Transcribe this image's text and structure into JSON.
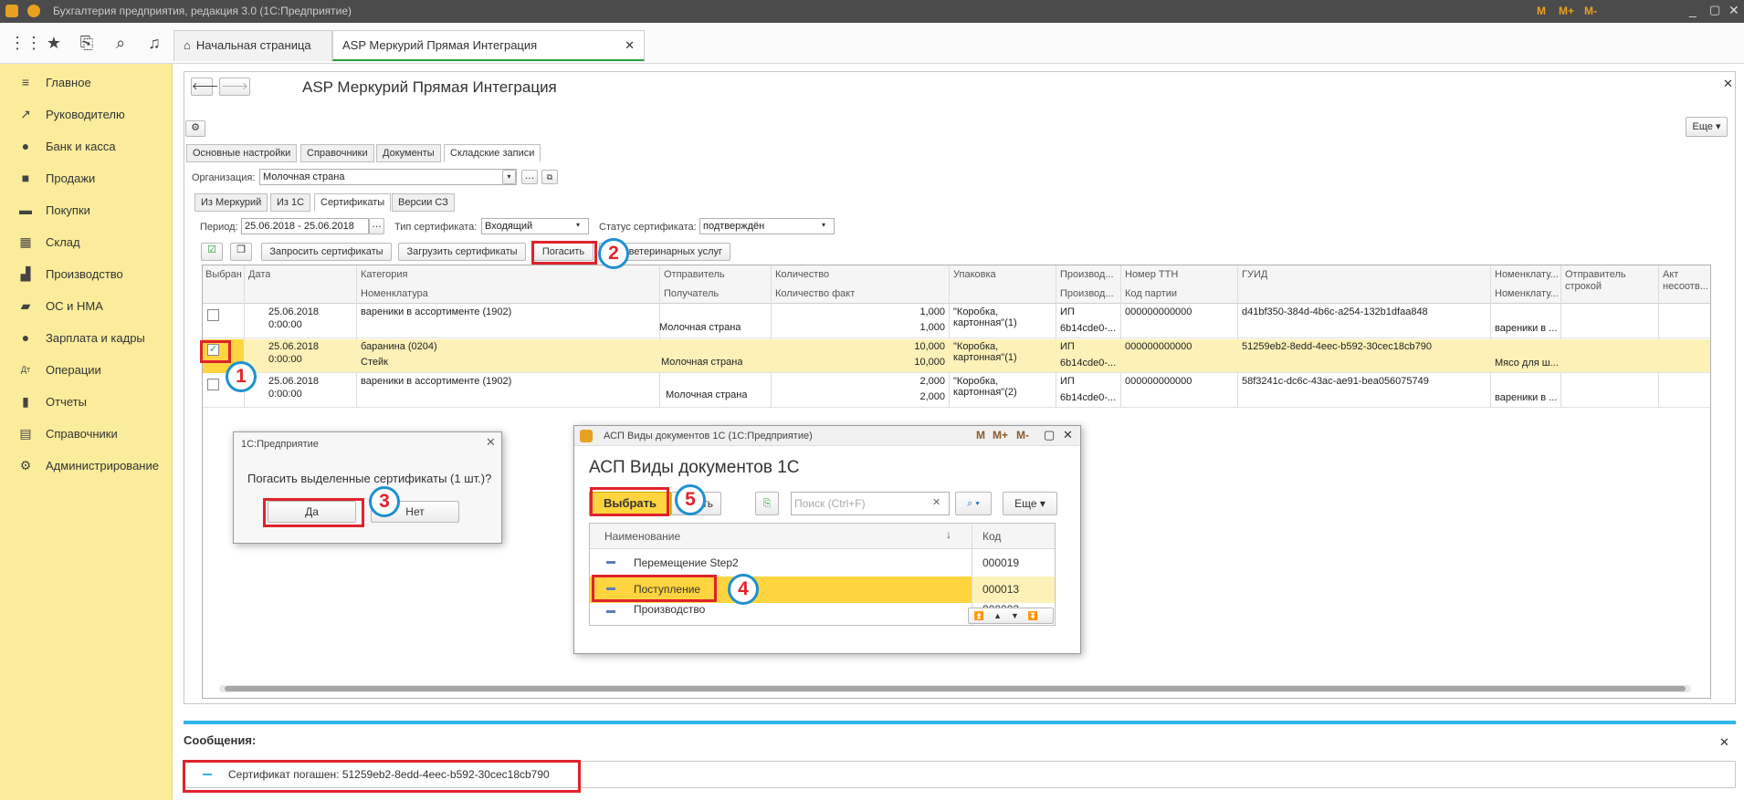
{
  "window": {
    "title": "Бухгалтерия предприятия, редакция 3.0  (1С:Предприятие)",
    "toolbar_right": [
      "M",
      "M+",
      "M-"
    ]
  },
  "tabs": [
    {
      "label": "Начальная страница"
    },
    {
      "label": "ASP Меркурий Прямая Интеграция"
    }
  ],
  "sidebar": {
    "items": [
      {
        "label": "Главное",
        "icon": "menu-icon"
      },
      {
        "label": "Руководителю",
        "icon": "chart-icon"
      },
      {
        "label": "Банк и касса",
        "icon": "ruble-icon"
      },
      {
        "label": "Продажи",
        "icon": "bag-icon"
      },
      {
        "label": "Покупки",
        "icon": "cart-icon"
      },
      {
        "label": "Склад",
        "icon": "grid-icon"
      },
      {
        "label": "Производство",
        "icon": "factory-icon"
      },
      {
        "label": "ОС и НМА",
        "icon": "truck-icon"
      },
      {
        "label": "Зарплата и кадры",
        "icon": "person-icon"
      },
      {
        "label": "Операции",
        "icon": "dt-kt-icon"
      },
      {
        "label": "Отчеты",
        "icon": "bar-chart-icon"
      },
      {
        "label": "Справочники",
        "icon": "book-icon"
      },
      {
        "label": "Администрирование",
        "icon": "gear-icon"
      }
    ]
  },
  "form": {
    "title": "ASP Меркурий Прямая Интеграция",
    "more_label": "Еще",
    "main_tabs": [
      "Основные настройки",
      "Справочники",
      "Документы",
      "Складские записи"
    ],
    "org_label": "Организация:",
    "org_value": "Молочная страна",
    "sub_tabs": [
      "Из Меркурий",
      "Из 1С",
      "Сертификаты",
      "Версии СЗ"
    ],
    "period_label": "Период:",
    "period_value": "25.06.2018 - 25.06.2018",
    "cert_type_label": "Тип сертификата:",
    "cert_type_value": "Входящий",
    "cert_status_label": "Статус сертификата:",
    "cert_status_value": "подтверждён",
    "buttons": {
      "request": "Запросить сертификаты",
      "load": "Загрузить сертификаты",
      "repay": "Погасить",
      "vet": "ветеринарных услуг"
    },
    "columns": {
      "selected": "Выбран",
      "date": "Дата",
      "category": "Категория",
      "nomenclature": "Номенклатура",
      "sender": "Отправитель",
      "receiver": "Получатель",
      "qty": "Количество",
      "qty_fact": "Количество факт",
      "pack": "Упаковка",
      "producer": "Производ...",
      "producer2": "Производ...",
      "ttn": "Номер ТТН",
      "batch": "Код партии",
      "guid": "ГУИД",
      "nom2": "Номенклату...",
      "nom3": "Номенклату...",
      "send_row": "Отправитель строкой",
      "act": "Акт несоотв..."
    },
    "rows": [
      {
        "checked": false,
        "date": "25.06.2018",
        "time": "0:00:00",
        "category": "вареники в ассортименте (1902)",
        "nomenclature": "",
        "sender": "",
        "receiver": "Молочная страна",
        "qty": "1,000",
        "qty_fact": "1,000",
        "pack1": "\"Коробка,",
        "pack2": "картонная\"(1)",
        "prod1": "ИП",
        "prod2": "6b14cde0-...",
        "ttn": "000000000000",
        "guid": "d41bf350-384d-4b6c-a254-132b1dfaa848",
        "nom": "вареники в ..."
      },
      {
        "checked": true,
        "date": "25.06.2018",
        "time": "0:00:00",
        "category": "баранина (0204)",
        "nomenclature": "Стейк",
        "sender": "",
        "receiver": "Молочная страна",
        "qty": "10,000",
        "qty_fact": "10,000",
        "pack1": "\"Коробка,",
        "pack2": "картонная\"(1)",
        "prod1": "ИП",
        "prod2": "6b14cde0-...",
        "ttn": "000000000000",
        "guid": "51259eb2-8edd-4eec-b592-30cec18cb790",
        "nom": "Мясо для ш..."
      },
      {
        "checked": false,
        "date": "25.06.2018",
        "time": "0:00:00",
        "category": "вареники в ассортименте (1902)",
        "nomenclature": "",
        "sender": "",
        "receiver": "Молочная страна",
        "qty": "2,000",
        "qty_fact": "2,000",
        "pack1": "\"Коробка,",
        "pack2": "картонная\"(2)",
        "prod1": "ИП",
        "prod2": "6b14cde0-...",
        "ttn": "000000000000",
        "guid": "58f3241c-dc6c-43ac-ae91-bea056075749",
        "nom": "вареники в ..."
      }
    ]
  },
  "confirm": {
    "title": "1С:Предприятие",
    "question": "Погасить выделенные сертификаты (1 шт.)?",
    "yes": "Да",
    "no": "Нет"
  },
  "doc_dialog": {
    "title": "АСП Виды документов 1С  (1С:Предприятие)",
    "heading": "АСП Виды документов 1С",
    "select": "Выбрать",
    "create_partial": "дать",
    "search_placeholder": "Поиск (Ctrl+F)",
    "more": "Еще",
    "col_name": "Наименование",
    "col_code": "Код",
    "rows": [
      {
        "name": "Перемещение Step2",
        "code": "000019"
      },
      {
        "name": "Поступление",
        "code": "000013"
      },
      {
        "name": "Производство",
        "code": "000003"
      }
    ]
  },
  "messages": {
    "title": "Сообщения:",
    "text": "Сертификат погашен: 51259eb2-8edd-4eec-b592-30cec18cb790"
  },
  "steps": [
    "1",
    "2",
    "3",
    "4",
    "5"
  ],
  "colors": {
    "sidebar": "#fbec9c",
    "highlight": "#fdf1b8",
    "select": "#ffd53f",
    "annotation": "#e0232c",
    "circle": "#1e90d0"
  }
}
